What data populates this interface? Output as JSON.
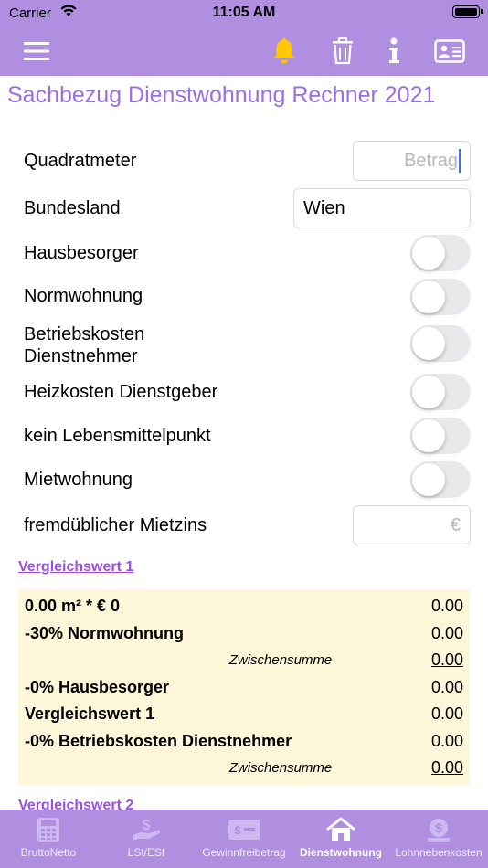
{
  "status_bar": {
    "carrier": "Carrier",
    "time": "11:05 AM"
  },
  "nav": {
    "icons": [
      "menu-icon",
      "bell-icon",
      "trash-icon",
      "info-icon",
      "contact-card-icon"
    ]
  },
  "colors": {
    "header": "#b08ee0",
    "title": "#9b6ee6",
    "bell": "#ffc800",
    "box": "#fdf6d9",
    "link": "#9b4ee6"
  },
  "title": "Sachbezug Dienstwohnung Rechner 2021",
  "form": {
    "quadratmeter": {
      "label": "Quadratmeter",
      "placeholder": "Betrag"
    },
    "bundesland": {
      "label": "Bundesland",
      "value": "Wien"
    },
    "hausbesorger": {
      "label": "Hausbesorger",
      "on": false
    },
    "normwohnung": {
      "label": "Normwohnung",
      "on": false
    },
    "betriebskosten": {
      "label_line1": "Betriebskosten",
      "label_line2": "Dienstnehmer",
      "on": false
    },
    "heizkosten": {
      "label": "Heizkosten Dienstgeber",
      "on": false
    },
    "lebensmittelpunkt": {
      "label": "kein Lebensmittelpunkt",
      "on": false
    },
    "mietwohnung": {
      "label": "Mietwohnung",
      "on": false
    },
    "mietzins": {
      "label": "fremdüblicher Mietzins",
      "placeholder": "€"
    }
  },
  "vergleichswert1": {
    "heading": "Vergleichswert 1",
    "rows": [
      {
        "label": "0.00 m² * € 0",
        "value": "0.00"
      },
      {
        "label": "-30% Normwohnung",
        "value": "0.00"
      },
      {
        "label": "Zwischensumme",
        "value": "0.00"
      },
      {
        "label": "-0% Hausbesorger",
        "value": "0.00"
      },
      {
        "label": "Vergleichswert 1",
        "value": "0.00"
      },
      {
        "label": "-0% Betriebskosten Dienstnehmer",
        "value": "0.00"
      },
      {
        "label": "Zwischensumme",
        "value": "0.00"
      }
    ]
  },
  "vergleichswert2": {
    "heading": "Vergleichswert 2"
  },
  "tabs": [
    {
      "label": "BruttoNetto",
      "icon": "calculator-icon",
      "active": false
    },
    {
      "label": "LSt/ESt",
      "icon": "hand-money-icon",
      "active": false
    },
    {
      "label": "Gewinnfreibetrag",
      "icon": "banknote-icon",
      "active": false
    },
    {
      "label": "Dienstwohnung",
      "icon": "house-icon",
      "active": true
    },
    {
      "label": "Lohnnebenkosten",
      "icon": "money-bag-icon",
      "active": false
    }
  ]
}
